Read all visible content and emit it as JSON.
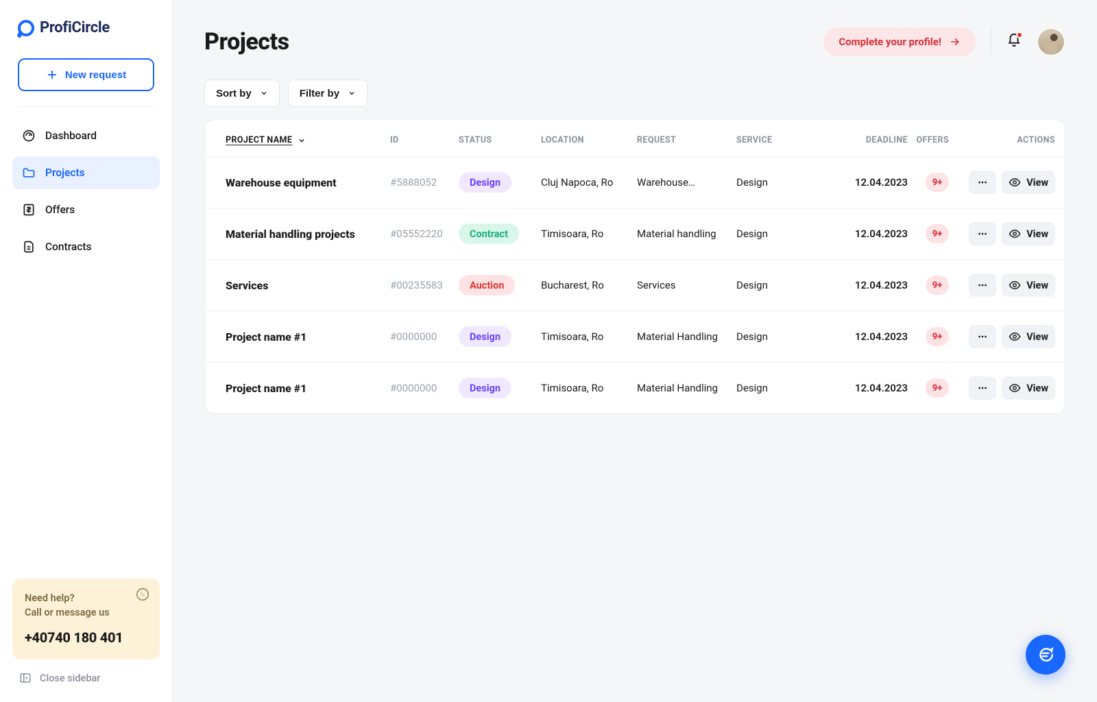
{
  "brand": {
    "name": "ProfiCircle"
  },
  "sidebar": {
    "new_request_label": "New request",
    "items": [
      {
        "label": "Dashboard",
        "icon": "dashboard-icon"
      },
      {
        "label": "Projects",
        "icon": "folder-icon",
        "active": true
      },
      {
        "label": "Offers",
        "icon": "offers-icon"
      },
      {
        "label": "Contracts",
        "icon": "contracts-icon"
      }
    ],
    "help": {
      "title_line1": "Need help?",
      "title_line2": "Call or message us",
      "phone": "+40740 180 401"
    },
    "close_label": "Close sidebar"
  },
  "header": {
    "page_title": "Projects",
    "complete_profile_label": "Complete your profile!",
    "notifications_unread": true
  },
  "toolbar": {
    "sort_label": "Sort by",
    "filter_label": "Filter by"
  },
  "table": {
    "columns": {
      "name": "PROJECT NAME",
      "id": "ID",
      "status": "STATUS",
      "location": "LOCATION",
      "request": "REQUEST",
      "service": "SERVICE",
      "deadline": "DEADLINE",
      "offers": "OFFERS",
      "actions": "ACTIONS"
    },
    "actions": {
      "view_label": "View"
    },
    "status_styles": {
      "Design": "status-design",
      "Contract": "status-contract",
      "Auction": "status-auction"
    },
    "rows": [
      {
        "name": "Warehouse equipment",
        "id": "#5888052",
        "status": "Design",
        "location": "Cluj Napoca, Ro",
        "request": "Warehouse…",
        "service": "Design",
        "deadline": "12.04.2023",
        "offers": "9+"
      },
      {
        "name": "Material handling projects",
        "id": "#05552220",
        "status": "Contract",
        "location": "Timisoara, Ro",
        "request": "Material handling",
        "service": "Design",
        "deadline": "12.04.2023",
        "offers": "9+"
      },
      {
        "name": "Services",
        "id": "#00235583",
        "status": "Auction",
        "location": "Bucharest, Ro",
        "request": "Services",
        "service": "Design",
        "deadline": "12.04.2023",
        "offers": "9+"
      },
      {
        "name": "Project name #1",
        "id": "#0000000",
        "status": "Design",
        "location": "Timisoara, Ro",
        "request": "Material Handling",
        "service": "Design",
        "deadline": "12.04.2023",
        "offers": "9+"
      },
      {
        "name": "Project name #1",
        "id": "#0000000",
        "status": "Design",
        "location": "Timisoara, Ro",
        "request": "Material Handling",
        "service": "Design",
        "deadline": "12.04.2023",
        "offers": "9+"
      }
    ]
  }
}
